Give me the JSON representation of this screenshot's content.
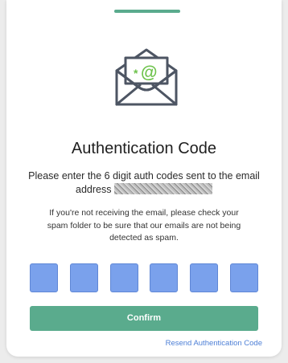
{
  "auth": {
    "title": "Authentication Code",
    "instruction_text": "Please enter the 6 digit auth codes sent to the email address",
    "spam_note": "If you're not receiving the email, please check your spam folder to be sure that our emails are not being detected as spam.",
    "code_digits": [
      "",
      "",
      "",
      "",
      "",
      ""
    ],
    "confirm_label": "Confirm",
    "resend_label": "Resend Authentication Code"
  },
  "icons": {
    "mail": "open-envelope-at-icon"
  },
  "colors": {
    "accent_green": "#5aab8d",
    "code_box_blue": "#7aa1ec",
    "link_blue": "#4d7fd6",
    "icon_stroke": "#4d5563",
    "icon_symbol": "#6cc24a"
  }
}
